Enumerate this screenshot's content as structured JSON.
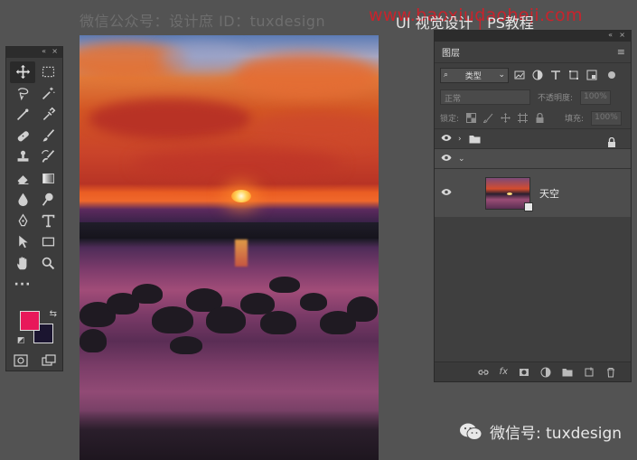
{
  "watermark": {
    "top_left": "微信公众号：设计庶  ID：tuxdesign",
    "url": "www.baoxiudaoheji.com",
    "title_left": "UI",
    "title_mid": "视觉设计",
    "title_sep": "|",
    "title_right": "PS教程",
    "wechat": "微信号: tuxdesign"
  },
  "toolbar": {
    "collapse": "«",
    "close": "×",
    "foreground_color": "#e8185a",
    "background_color": "#1b1530",
    "tools": [
      {
        "name": "move-tool",
        "icon": "move-icon",
        "active": true
      },
      {
        "name": "marquee-tool",
        "icon": "marquee-icon"
      },
      {
        "name": "lasso-tool",
        "icon": "lasso-icon"
      },
      {
        "name": "magic-wand-tool",
        "icon": "magic-wand-icon"
      },
      {
        "name": "crop-tool",
        "icon": "crop-icon"
      },
      {
        "name": "eyedropper-tool",
        "icon": "eyedropper-icon"
      },
      {
        "name": "healing-tool",
        "icon": "bandage-icon"
      },
      {
        "name": "brush-tool",
        "icon": "brush-icon"
      },
      {
        "name": "stamp-tool",
        "icon": "stamp-icon"
      },
      {
        "name": "history-brush-tool",
        "icon": "history-brush-icon"
      },
      {
        "name": "eraser-tool",
        "icon": "eraser-icon"
      },
      {
        "name": "gradient-tool",
        "icon": "gradient-icon"
      },
      {
        "name": "blur-tool",
        "icon": "blur-icon"
      },
      {
        "name": "dodge-tool",
        "icon": "dodge-icon"
      },
      {
        "name": "pen-tool",
        "icon": "pen-icon"
      },
      {
        "name": "type-tool",
        "icon": "type-icon"
      },
      {
        "name": "path-select-tool",
        "icon": "arrow-icon"
      },
      {
        "name": "shape-tool",
        "icon": "rectangle-icon"
      },
      {
        "name": "hand-tool",
        "icon": "hand-icon"
      },
      {
        "name": "zoom-tool",
        "icon": "zoom-icon"
      }
    ],
    "more": "···"
  },
  "layers_panel": {
    "collapse": "«",
    "close": "×",
    "tab_label": "图层",
    "menu": "≡",
    "filter_label": "类型",
    "blend_mode": "正常",
    "opacity_label": "不透明度:",
    "opacity_value": "100%",
    "lock_label": "锁定:",
    "fill_label": "填充:",
    "fill_value": "100%",
    "layers": [
      {
        "name": "",
        "type": "group",
        "expanded": false,
        "locked": true,
        "visible": true
      },
      {
        "name": "",
        "type": "group",
        "expanded": true,
        "visible": true,
        "selected": true
      },
      {
        "name": "天空",
        "type": "smart-object",
        "visible": true
      }
    ]
  }
}
